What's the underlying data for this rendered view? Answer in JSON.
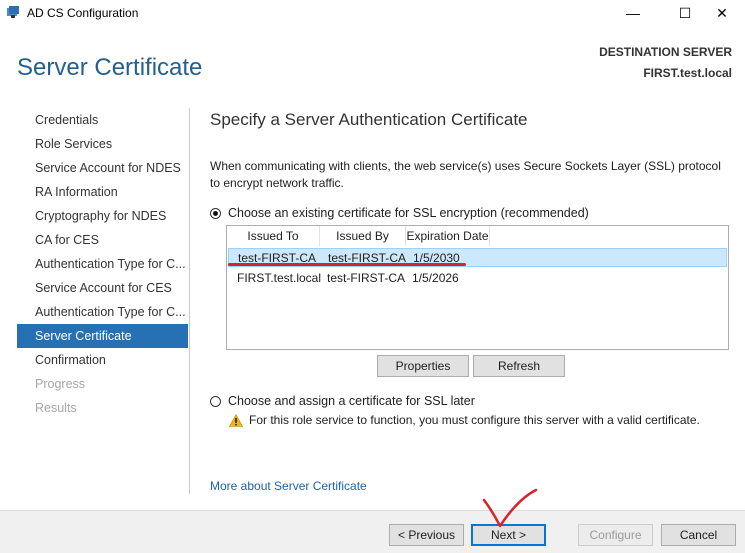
{
  "window": {
    "title": "AD CS Configuration",
    "min_glyph": "—",
    "max_glyph": "☐",
    "close_glyph": "✕"
  },
  "header": {
    "title": "Server Certificate",
    "destination_label": "DESTINATION SERVER",
    "destination_server": "FIRST.test.local"
  },
  "nav": {
    "items": [
      {
        "label": "Credentials",
        "state": "normal"
      },
      {
        "label": "Role Services",
        "state": "normal"
      },
      {
        "label": "Service Account for NDES",
        "state": "normal"
      },
      {
        "label": "RA Information",
        "state": "normal"
      },
      {
        "label": "Cryptography for NDES",
        "state": "normal"
      },
      {
        "label": "CA for CES",
        "state": "normal"
      },
      {
        "label": "Authentication Type for C...",
        "state": "normal"
      },
      {
        "label": "Service Account for CES",
        "state": "normal"
      },
      {
        "label": "Authentication Type for C...",
        "state": "normal"
      },
      {
        "label": "Server Certificate",
        "state": "active"
      },
      {
        "label": "Confirmation",
        "state": "normal"
      },
      {
        "label": "Progress",
        "state": "disabled"
      },
      {
        "label": "Results",
        "state": "disabled"
      }
    ]
  },
  "content": {
    "title": "Specify a Server Authentication Certificate",
    "description": "When communicating with clients, the web service(s) uses Secure Sockets Layer (SSL) protocol to encrypt network traffic.",
    "option_existing": "Choose an existing certificate for SSL encryption (recommended)",
    "option_later": "Choose and assign a certificate for SSL later",
    "warning": "For this role service to function, you must configure this server with a valid certificate.",
    "more_link": "More about Server Certificate"
  },
  "cert_table": {
    "columns": [
      "Issued To",
      "Issued By",
      "Expiration Date"
    ],
    "rows": [
      {
        "issued_to": "test-FIRST-CA",
        "issued_by": "test-FIRST-CA",
        "expiration": "1/5/2030",
        "selected": true
      },
      {
        "issued_to": "FIRST.test.local",
        "issued_by": "test-FIRST-CA",
        "expiration": "1/5/2026",
        "selected": false
      }
    ]
  },
  "buttons": {
    "properties": "Properties",
    "refresh": "Refresh",
    "previous": "< Previous",
    "next": "Next >",
    "configure": "Configure",
    "cancel": "Cancel"
  },
  "colors": {
    "accent": "#2670b4",
    "header_title": "#245f8d",
    "selection": "#cce8ff",
    "annotation": "#d8232a"
  }
}
